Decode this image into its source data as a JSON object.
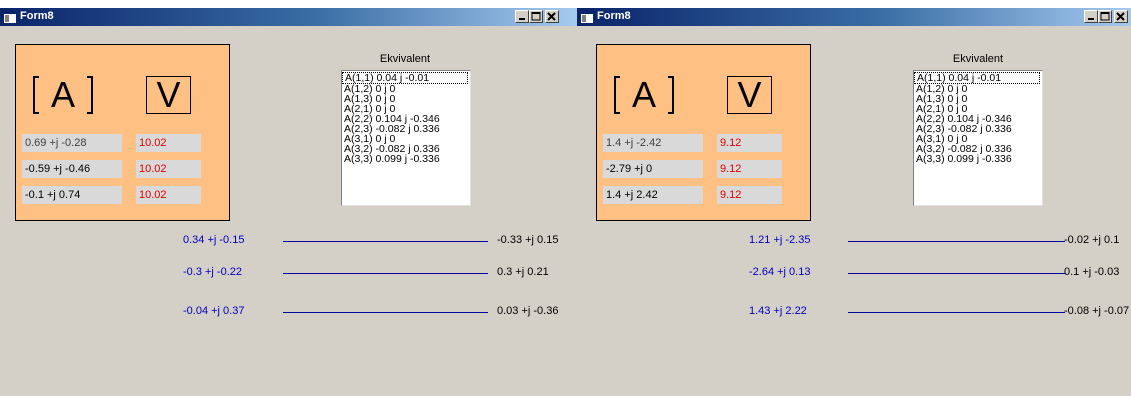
{
  "windows": [
    {
      "title": "Form8",
      "matrix_label": "A",
      "vector_label": "V",
      "a_values": [
        "0.69 +j -0.28",
        "-0.59 +j -0.46",
        "-0.1 +j 0.74"
      ],
      "v_values": [
        "10.02",
        "10.02",
        "10.02"
      ],
      "ekvivalent_label": "Ekvivalent",
      "ekvivalent_items": [
        "A(1,1) 0.04 j -0.01",
        "A(1,2) 0 j 0",
        "A(1,3) 0 j 0",
        "A(2,1) 0 j 0",
        "A(2,2) 0.104 j -0.346",
        "A(2,3) -0.082 j 0.336",
        "A(3,1) 0 j 0",
        "A(3,2) -0.082 j 0.336",
        "A(3,3) 0.099 j -0.336"
      ],
      "rows": [
        {
          "input": "0.34 +j -0.15",
          "result": "-0.33 +j 0.15"
        },
        {
          "input": "-0.3 +j -0.22",
          "result": "0.3 +j 0.21"
        },
        {
          "input": "-0.04 +j 0.37",
          "result": "0.03 +j -0.36"
        }
      ]
    },
    {
      "title": "Form8",
      "matrix_label": "A",
      "vector_label": "V",
      "a_values": [
        "1.4 +j -2.42",
        "-2.79 +j 0",
        "1.4 +j 2.42"
      ],
      "v_values": [
        "9.12",
        "9.12",
        "9.12"
      ],
      "ekvivalent_label": "Ekvivalent",
      "ekvivalent_items": [
        "A(1,1) 0.04 j -0.01",
        "A(1,2) 0 j 0",
        "A(1,3) 0 j 0",
        "A(2,1) 0 j 0",
        "A(2,2) 0.104 j -0.346",
        "A(2,3) -0.082 j 0.336",
        "A(3,1) 0 j 0",
        "A(3,2) -0.082 j 0.336",
        "A(3,3) 0.099 j -0.336"
      ],
      "rows": [
        {
          "input": "1.21 +j -2.35",
          "result": "-0.02 +j 0.1"
        },
        {
          "input": "-2.64 +j 0.13",
          "result": "0.1 +j -0.03"
        },
        {
          "input": "1.43 +j 2.22",
          "result": "-0.08 +j -0.07"
        }
      ]
    }
  ],
  "colors": {
    "panel": "#ffc084",
    "input_text": "#0000c0",
    "v_text": "#e00000",
    "line": "#0000a0"
  },
  "icons": [
    "form-icon",
    "minimize-icon",
    "maximize-icon",
    "close-icon"
  ]
}
